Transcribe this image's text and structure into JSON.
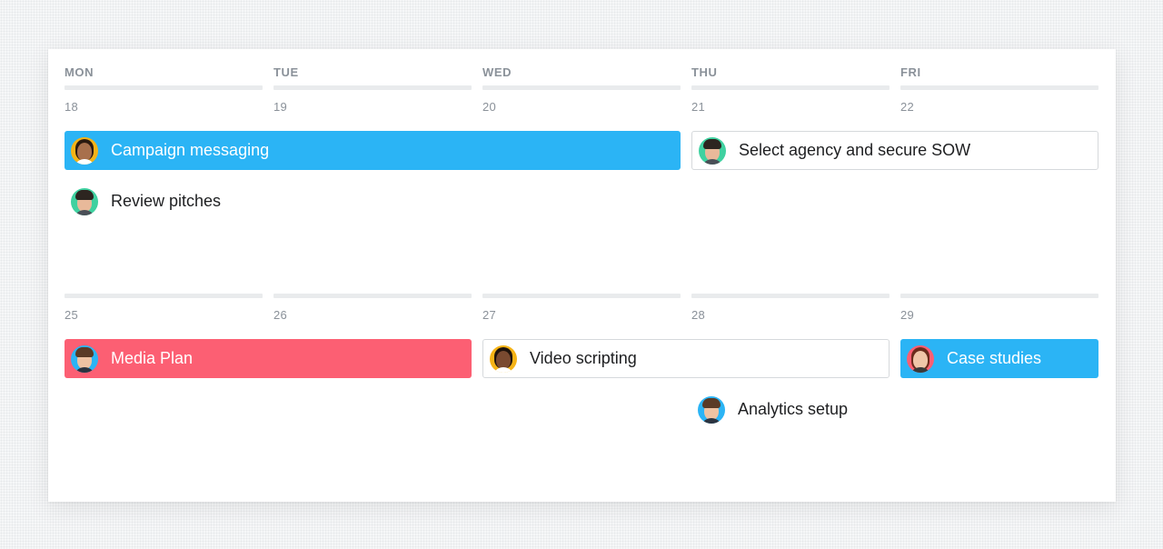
{
  "calendar": {
    "days": [
      "MON",
      "TUE",
      "WED",
      "THU",
      "FRI"
    ],
    "week1_dates": [
      "18",
      "19",
      "20",
      "21",
      "22"
    ],
    "week2_dates": [
      "25",
      "26",
      "27",
      "28",
      "29"
    ]
  },
  "tasks": {
    "campaign_messaging": {
      "label": "Campaign messaging",
      "color": "#2bb4f5",
      "avatar": "woman-avatar-icon"
    },
    "select_agency": {
      "label": "Select agency and secure SOW",
      "avatar": "man-avatar-icon"
    },
    "review_pitches": {
      "label": "Review pitches",
      "avatar": "man-avatar-icon"
    },
    "media_plan": {
      "label": "Media Plan",
      "color": "#fc5f73",
      "avatar": "man-glasses-avatar-icon"
    },
    "video_scripting": {
      "label": "Video scripting",
      "avatar": "woman-avatar-icon"
    },
    "case_studies": {
      "label": "Case studies",
      "color": "#2bb4f5",
      "avatar": "woman-avatar-icon"
    },
    "analytics_setup": {
      "label": "Analytics setup",
      "avatar": "man-glasses-avatar-icon"
    }
  },
  "colors": {
    "blue": "#2bb4f5",
    "red": "#fc5f73",
    "header_text": "#8a9199",
    "divider": "#e9ebed"
  }
}
